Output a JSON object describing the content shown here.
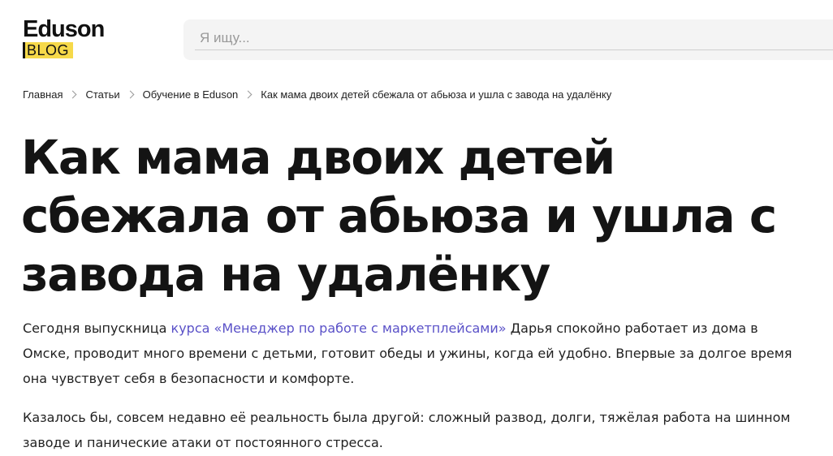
{
  "header": {
    "logo_word": "Eduson",
    "logo_badge": "BLOG",
    "search_placeholder": "Я ищу..."
  },
  "breadcrumb": [
    "Главная",
    "Статьи",
    "Обучение в Eduson",
    "Как мама двоих детей сбежала от абьюза и ушла с завода на удалёнку"
  ],
  "article": {
    "title": "Как мама двоих детей сбежала от абьюза и ушла с завода на удалёнку",
    "p1_before": "Сегодня выпускница ",
    "p1_link": "курса «Менеджер по работе с маркетплейсами»",
    "p1_after": " Дарья спокойно работает из дома в Омске, проводит много времени с детьми, готовит обеды и ужины, когда ей удобно. Впервые за долгое время она чувствует себя в безопасности и комфорте.",
    "p2": "Казалось бы, совсем недавно её реальность была другой: сложный развод, долги, тяжёлая работа на шинном заводе и панические атаки от постоянного стресса."
  },
  "colors": {
    "accent_link": "#5a51c8",
    "logo_badge_bg": "#f6d94a"
  }
}
